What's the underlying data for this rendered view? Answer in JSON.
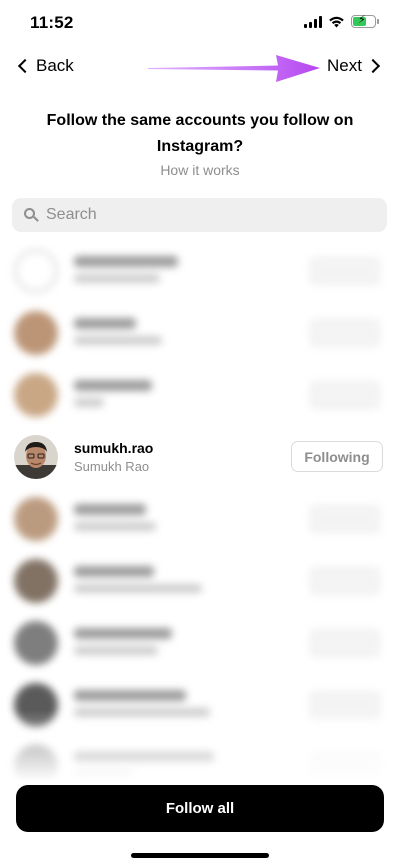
{
  "status_bar": {
    "time": "11:52"
  },
  "nav": {
    "back_label": "Back",
    "next_label": "Next"
  },
  "header": {
    "title": "Follow the same accounts you follow on Instagram?",
    "how_it_works": "How it works"
  },
  "search": {
    "placeholder": "Search"
  },
  "accounts": [
    {
      "blurred": true,
      "avatar": "outline",
      "line1_w": 104,
      "line2_w": 86
    },
    {
      "blurred": true,
      "avatar": "#b0835f",
      "line1_w": 62,
      "line2_w": 88
    },
    {
      "blurred": true,
      "avatar": "#c09870",
      "line1_w": 78,
      "line2_w": 30
    },
    {
      "blurred": false,
      "username": "sumukh.rao",
      "fullname": "Sumukh Rao",
      "button_label": "Following"
    },
    {
      "blurred": true,
      "avatar": "#b08a6a",
      "line1_w": 72,
      "line2_w": 82
    },
    {
      "blurred": true,
      "avatar": "#6c5a4a",
      "line1_w": 80,
      "line2_w": 128
    },
    {
      "blurred": true,
      "avatar": "#686868",
      "line1_w": 98,
      "line2_w": 84
    },
    {
      "blurred": true,
      "avatar": "#3e3e3e",
      "line1_w": 112,
      "line2_w": 136
    },
    {
      "blurred": true,
      "avatar": "#7a7a7a",
      "line1_w": 140,
      "line2_w": 60
    }
  ],
  "footer": {
    "follow_all_label": "Follow all"
  },
  "colors": {
    "annotation_arrow": "#b645f0",
    "battery": "#34c759",
    "secondary_text": "#8e8e8e"
  },
  "icons": [
    "signal-icon",
    "wifi-icon",
    "battery-charging-icon",
    "chevron-left-icon",
    "chevron-right-icon",
    "search-icon"
  ]
}
